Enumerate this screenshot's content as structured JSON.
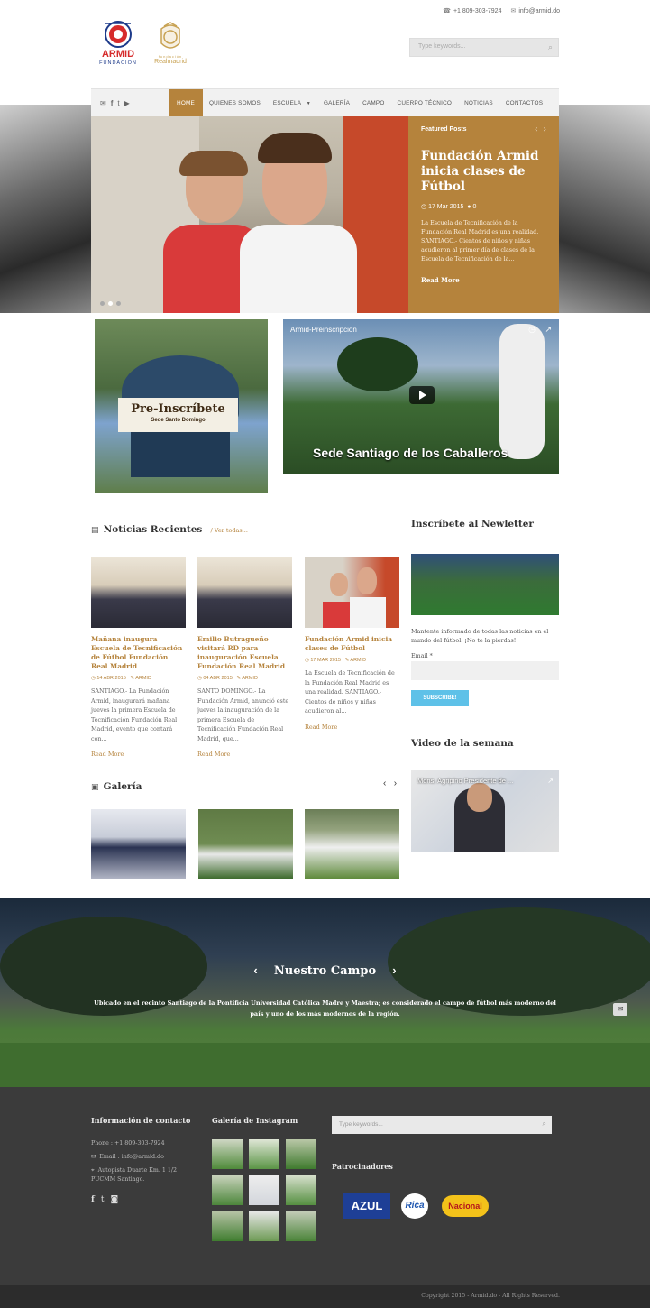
{
  "topbar": {
    "phone": "+1 809-303-7924",
    "email": "info@armid.do"
  },
  "logos": {
    "armid_top": "ARMID",
    "armid_bottom": "FUNDACIÓN",
    "rm_small": "fundación",
    "rm_big": "Realmadrid"
  },
  "search": {
    "placeholder": "Type keywords..."
  },
  "nav": {
    "items": [
      "HOME",
      "QUIENES SOMOS",
      "ESCUELA",
      "GALERÍA",
      "CAMPO",
      "CUERPO TÉCNICO",
      "NOTICIAS",
      "CONTACTOS"
    ],
    "dropdown_icon": "chevron-down-icon"
  },
  "featured": {
    "label": "Featured Posts",
    "title": "Fundación Armid inicia clases de Fútbol",
    "date": "17 Mar 2015",
    "comments": "0",
    "text": "La Escuela de Tecnificación de la Fundación Real Madrid es una realidad. SANTIAGO.- Cientos de niños y niñas acudieron al primer día de clases de la Escuela de Tecnificación de la...",
    "more": "Read More"
  },
  "promo": {
    "pre_title": "Pre-Inscríbete",
    "pre_sub": "Sede Santo Domingo",
    "video_title": "Armid-Preinscripción",
    "video_caption": "Sede Santiago de los Caballeros"
  },
  "news": {
    "heading": "Noticias Recientes",
    "see_all": "Ver todas...",
    "cards": [
      {
        "title": "Mañana inaugura Escuela de Tecnificación de Fútbol Fundación Real Madrid",
        "date": "14 ABR 2015",
        "author": "ARMID",
        "text": "SANTIAGO.- La Fundación Armid, inaugurará mañana jueves la primera Escuela de Tecnificación Fundación Real Madrid, evento que contará con...",
        "more": "Read More"
      },
      {
        "title": "Emilio Butragueño visitará RD para inauguración Escuela Fundación Real Madrid",
        "date": "04 ABR 2015",
        "author": "ARMID",
        "text": "SANTO DOMINGO.- La Fundación Armid, anunció este jueves la inauguración de la primera Escuela de Tecnificación Fundación Real Madrid, que...",
        "more": "Read More"
      },
      {
        "title": "Fundación Armid inicia clases de Fútbol",
        "date": "17 MAR 2015",
        "author": "ARMID",
        "text": "La Escuela de Tecnificación de la Fundación Real Madrid es una realidad. SANTIAGO.- Cientos de niños y niñas acudieron al...",
        "more": "Read More"
      }
    ]
  },
  "gallery": {
    "heading": "Galería"
  },
  "newsletter": {
    "heading": "Inscríbete al Newletter",
    "text": "Mantente informado de todas las noticias en el mundo del fútbol. ¡No te la pierdas!",
    "email_label": "Email *",
    "button": "SUBSCRIBE!"
  },
  "video_week": {
    "heading": "Video de la semana",
    "title": "Mons. Agripino Presidente de ..."
  },
  "campo": {
    "title": "Nuestro Campo",
    "text": "Ubicado en el recinto Santiago de la Pontificia Universidad Católica Madre y Maestra; es considerado el campo de fútbol más moderno del país y uno de los más modernos de la región."
  },
  "footer": {
    "contact_heading": "Información de contacto",
    "phone": "Phone : +1 809-303-7924",
    "email": "Email : info@armid.do",
    "address": "Autopista Duarte Km. 1 1/2 PUCMM Santiago.",
    "instagram_heading": "Galería de Instagram",
    "search_placeholder": "Type keywords...",
    "sponsors_heading": "Patrocinadores",
    "sponsors": [
      "AZUL",
      "Rica",
      "Nacional"
    ],
    "copyright": "Copyright 2015 - Armid.do - All Rights Reserved."
  },
  "colors": {
    "accent": "#b5833c",
    "button": "#5ec1e8",
    "footer": "#3b3b3b"
  }
}
